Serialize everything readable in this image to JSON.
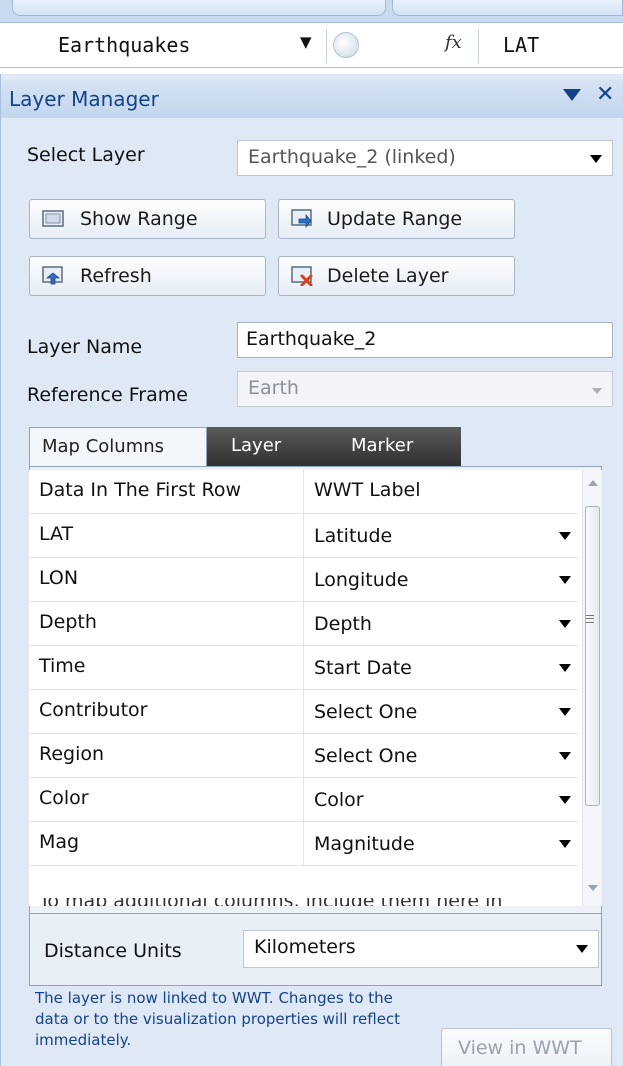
{
  "formula_bar": {
    "name_box": "Earthquakes",
    "fx_symbol": "fx",
    "formula": "LAT"
  },
  "panel": {
    "title": "Layer Manager",
    "select_layer_label": "Select Layer",
    "select_layer_value": "Earthquake_2 (linked)",
    "buttons": {
      "show_range": "Show Range",
      "update_range": "Update Range",
      "refresh": "Refresh",
      "delete_layer": "Delete Layer"
    },
    "layer_name_label": "Layer Name",
    "layer_name_value": "Earthquake_2",
    "reference_frame_label": "Reference Frame",
    "reference_frame_value": "Earth",
    "tabs": [
      {
        "label": "Map Columns"
      },
      {
        "label": "Layer"
      },
      {
        "label": "Marker"
      }
    ],
    "grid": {
      "headers": [
        "Data In The First Row",
        "WWT Label"
      ],
      "rows": [
        {
          "data": "LAT",
          "label": "Latitude"
        },
        {
          "data": "LON",
          "label": "Longitude"
        },
        {
          "data": "Depth",
          "label": "Depth"
        },
        {
          "data": "Time",
          "label": "Start Date"
        },
        {
          "data": "Contributor",
          "label": "Select One"
        },
        {
          "data": "Region",
          "label": "Select One"
        },
        {
          "data": "Color",
          "label": "Color"
        },
        {
          "data": "Mag",
          "label": "Magnitude"
        }
      ],
      "clipped_text": "To map additional columns, include them here in"
    },
    "distance_units_label": "Distance Units",
    "distance_units_value": "Kilometers",
    "info_text": "The layer is now linked to WWT. Changes to the data or to the visualization properties will reflect immediately.",
    "view_button": "View in WWT"
  }
}
